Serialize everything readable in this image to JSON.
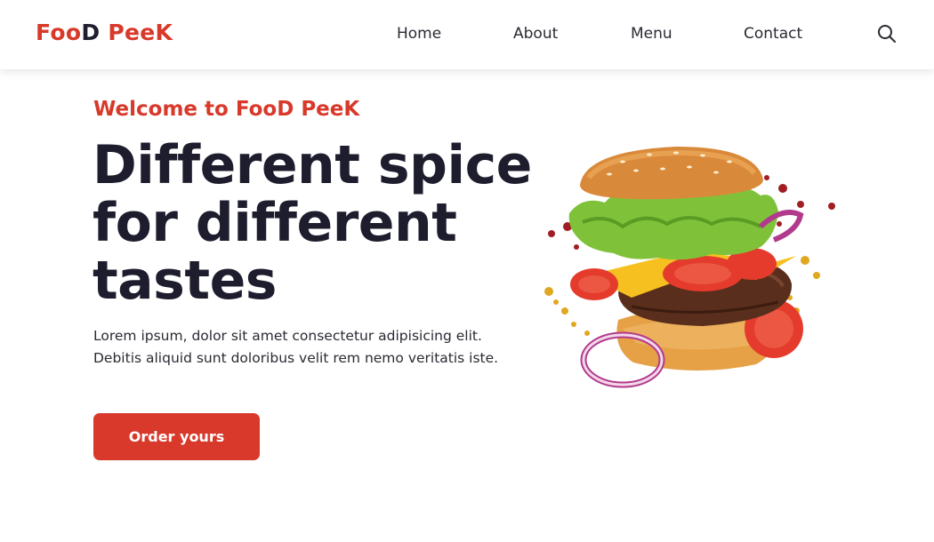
{
  "brand": {
    "part1": "Foo",
    "part2": "D",
    "part3": " Pee",
    "part4": "K"
  },
  "nav": {
    "items": [
      "Home",
      "About",
      "Menu",
      "Contact"
    ]
  },
  "icons": {
    "search": "search-icon"
  },
  "hero": {
    "subtitle": "Welcome to FooD PeeK",
    "title_lines": [
      "Different spice",
      "for different",
      "tastes"
    ],
    "text_lines": [
      "Lorem ipsum, dolor sit amet consectetur adipisicing elit.",
      "Debitis aliquid sunt doloribus velit rem nemo veritatis iste."
    ],
    "cta_label": "Order yours",
    "image": "burger-illustration"
  },
  "colors": {
    "accent": "#d8392a",
    "dark_text": "#1e1d2e"
  }
}
